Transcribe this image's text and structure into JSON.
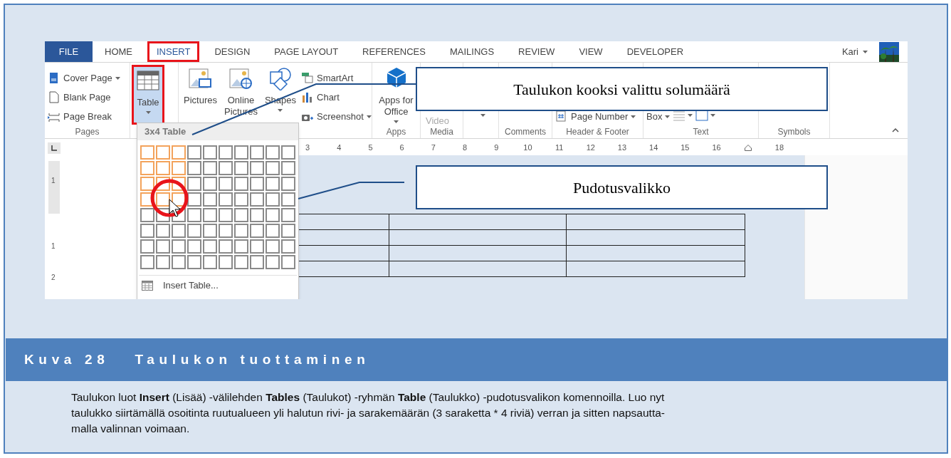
{
  "word_window": {
    "tabs": [
      {
        "label": "FILE",
        "kind": "file",
        "selected": false,
        "highlighted": false
      },
      {
        "label": "HOME",
        "kind": "tab",
        "selected": false,
        "highlighted": false
      },
      {
        "label": "INSERT",
        "kind": "tab",
        "selected": true,
        "highlighted": true
      },
      {
        "label": "DESIGN",
        "kind": "tab",
        "selected": false,
        "highlighted": false
      },
      {
        "label": "PAGE LAYOUT",
        "kind": "tab",
        "selected": false,
        "highlighted": false
      },
      {
        "label": "REFERENCES",
        "kind": "tab",
        "selected": false,
        "highlighted": false
      },
      {
        "label": "MAILINGS",
        "kind": "tab",
        "selected": false,
        "highlighted": false
      },
      {
        "label": "REVIEW",
        "kind": "tab",
        "selected": false,
        "highlighted": false
      },
      {
        "label": "VIEW",
        "kind": "tab",
        "selected": false,
        "highlighted": false
      },
      {
        "label": "DEVELOPER",
        "kind": "tab",
        "selected": false,
        "highlighted": false
      }
    ],
    "user": {
      "name": "Kari"
    },
    "ribbon_groups": [
      {
        "label": "Pages",
        "items": [
          {
            "kind": "small",
            "label": "Cover Page",
            "dropdown": true
          },
          {
            "kind": "small",
            "label": "Blank Page",
            "dropdown": false
          },
          {
            "kind": "small",
            "label": "Page Break",
            "dropdown": false
          }
        ]
      },
      {
        "items": [
          {
            "kind": "large",
            "label": "Table",
            "dropdown": true,
            "selected": true,
            "highlighted": true
          }
        ]
      },
      {
        "items": [
          {
            "kind": "large",
            "label": "Pictures",
            "dropdown": false
          },
          {
            "kind": "large",
            "label": "Online Pictures",
            "dropdown": false
          },
          {
            "kind": "large",
            "label": "Shapes",
            "dropdown": true
          },
          {
            "kind": "small",
            "label": "SmartArt",
            "dropdown": false
          },
          {
            "kind": "small",
            "label": "Chart",
            "dropdown": false
          },
          {
            "kind": "small",
            "label": "Screenshot",
            "dropdown": true
          }
        ]
      },
      {
        "label": "Apps",
        "items": [
          {
            "kind": "large",
            "label": "Apps for Office",
            "dropdown": true
          }
        ]
      },
      {
        "label": "Media",
        "items": [
          {
            "kind": "large",
            "label": "Video",
            "dropdown": false,
            "disabled": true
          }
        ]
      },
      {
        "items": [
          {
            "kind": "covered",
            "dropdown": true
          }
        ]
      },
      {
        "label": "Comments"
      },
      {
        "label": "Header & Footer",
        "items": [
          {
            "kind": "small",
            "label": "Page Number",
            "dropdown": true
          }
        ]
      },
      {
        "label": "Text",
        "items": [
          {
            "kind": "small",
            "label": "Box",
            "dropdown": true
          },
          {
            "kind": "icon_small",
            "dropdown": true
          },
          {
            "kind": "icon_small",
            "dropdown": true
          }
        ]
      },
      {
        "label": "Symbols"
      }
    ],
    "ruler": {
      "marks": [
        {
          "kind": "number",
          "label": "3"
        },
        {
          "kind": "number",
          "label": "4"
        },
        {
          "kind": "number",
          "label": "5"
        },
        {
          "kind": "number",
          "label": "6"
        },
        {
          "kind": "number",
          "label": "7"
        },
        {
          "kind": "number",
          "label": "8"
        },
        {
          "kind": "number",
          "label": "9"
        },
        {
          "kind": "number",
          "label": "10"
        },
        {
          "kind": "number",
          "label": "11"
        },
        {
          "kind": "number",
          "label": "12"
        },
        {
          "kind": "number",
          "label": "13"
        },
        {
          "kind": "number",
          "label": "14"
        },
        {
          "kind": "number",
          "label": "15"
        },
        {
          "kind": "number",
          "label": "16"
        },
        {
          "kind": "indent_marker"
        },
        {
          "kind": "number",
          "label": "18"
        }
      ],
      "vertical_marks": [
        "1",
        "1",
        "2"
      ]
    },
    "table_menu": {
      "header": "3x4 Table",
      "grid": [
        {
          "cells": [
            {
              "selected": true
            },
            {
              "selected": true
            },
            {
              "selected": true
            },
            {
              "selected": false
            },
            {
              "selected": false
            },
            {
              "selected": false
            },
            {
              "selected": false
            },
            {
              "selected": false
            },
            {
              "selected": false
            },
            {
              "selected": false
            }
          ]
        },
        {
          "cells": [
            {
              "selected": true
            },
            {
              "selected": true
            },
            {
              "selected": true
            },
            {
              "selected": false
            },
            {
              "selected": false
            },
            {
              "selected": false
            },
            {
              "selected": false
            },
            {
              "selected": false
            },
            {
              "selected": false
            },
            {
              "selected": false
            }
          ]
        },
        {
          "cells": [
            {
              "selected": true
            },
            {
              "selected": true
            },
            {
              "selected": true
            },
            {
              "selected": false
            },
            {
              "selected": false
            },
            {
              "selected": false
            },
            {
              "selected": false
            },
            {
              "selected": false
            },
            {
              "selected": false
            },
            {
              "selected": false
            }
          ]
        },
        {
          "cells": [
            {
              "selected": true
            },
            {
              "selected": true
            },
            {
              "selected": true
            },
            {
              "selected": false
            },
            {
              "selected": false
            },
            {
              "selected": false
            },
            {
              "selected": false
            },
            {
              "selected": false
            },
            {
              "selected": false
            },
            {
              "selected": false
            }
          ]
        },
        {
          "cells": [
            {
              "selected": false
            },
            {
              "selected": false
            },
            {
              "selected": false
            },
            {
              "selected": false
            },
            {
              "selected": false
            },
            {
              "selected": false
            },
            {
              "selected": false
            },
            {
              "selected": false
            },
            {
              "selected": false
            },
            {
              "selected": false
            }
          ]
        },
        {
          "cells": [
            {
              "selected": false
            },
            {
              "selected": false
            },
            {
              "selected": false
            },
            {
              "selected": false
            },
            {
              "selected": false
            },
            {
              "selected": false
            },
            {
              "selected": false
            },
            {
              "selected": false
            },
            {
              "selected": false
            },
            {
              "selected": false
            }
          ]
        },
        {
          "cells": [
            {
              "selected": false
            },
            {
              "selected": false
            },
            {
              "selected": false
            },
            {
              "selected": false
            },
            {
              "selected": false
            },
            {
              "selected": false
            },
            {
              "selected": false
            },
            {
              "selected": false
            },
            {
              "selected": false
            },
            {
              "selected": false
            }
          ]
        },
        {
          "cells": [
            {
              "selected": false
            },
            {
              "selected": false
            },
            {
              "selected": false
            },
            {
              "selected": false
            },
            {
              "selected": false
            },
            {
              "selected": false
            },
            {
              "selected": false
            },
            {
              "selected": false
            },
            {
              "selected": false
            },
            {
              "selected": false
            }
          ]
        }
      ],
      "commands": [
        "Insert Table..."
      ]
    }
  },
  "callouts": [
    "Taulukon kooksi valittu solumäärä",
    "Pudotusvalikko"
  ],
  "caption": {
    "number": "Kuva 28",
    "title": "Taulukon tuottaminen"
  },
  "body_text": "Taulukon luot **Insert** (Lisää) -välilehden **Tables** (Taulukot) -ryhmän **Table** (Taulukko) -pudotusvalikon komennoilla. Luo nyt\ntaulukko siirtämällä osoitinta ruutualueen yli halutun rivi- ja sarakemäärän (3 saraketta * 4 riviä) verran ja sitten napsautta-\nmalla valinnan voimaan."
}
